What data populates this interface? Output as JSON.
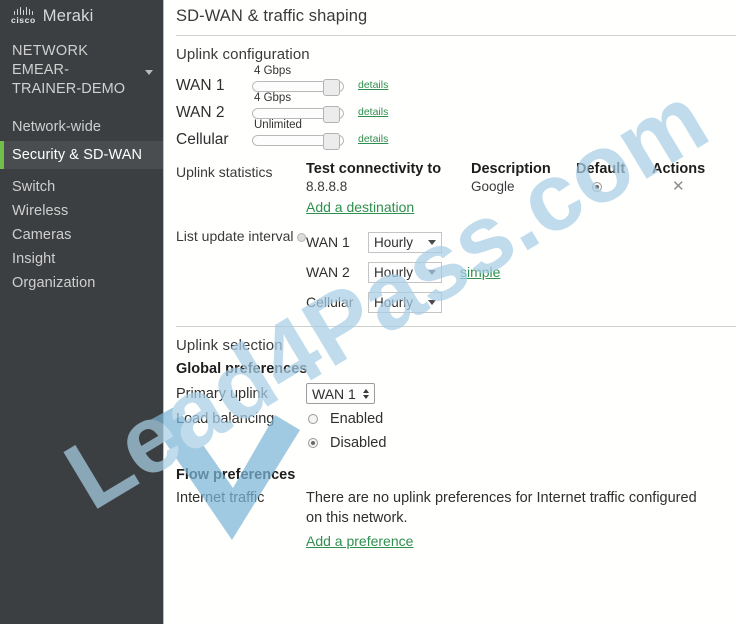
{
  "brand": {
    "cisco": "cisco",
    "product": "Meraki"
  },
  "sidebar": {
    "network_label": "NETWORK",
    "network_name": "EMEAR-TRAINER-DEMO",
    "items": [
      {
        "label": "Network-wide",
        "active": false
      },
      {
        "label": "Security & SD-WAN",
        "active": true
      },
      {
        "label": "Switch",
        "active": false
      },
      {
        "label": "Wireless",
        "active": false
      },
      {
        "label": "Cameras",
        "active": false
      },
      {
        "label": "Insight",
        "active": false
      },
      {
        "label": "Organization",
        "active": false
      }
    ],
    "accent_color": "#6fbf4a",
    "background_color": "#3c3f41"
  },
  "page": {
    "title": "SD-WAN & traffic shaping"
  },
  "uplink_configuration": {
    "heading": "Uplink configuration",
    "rows": [
      {
        "name": "WAN 1",
        "value": "4 Gbps",
        "details_label": "details"
      },
      {
        "name": "WAN 2",
        "value": "4 Gbps",
        "details_label": "details"
      },
      {
        "name": "Cellular",
        "value": "Unlimited",
        "details_label": "details"
      }
    ]
  },
  "uplink_statistics": {
    "label": "Uplink statistics",
    "columns": [
      "Test connectivity to",
      "Description",
      "Default",
      "Actions"
    ],
    "rows": [
      {
        "test": "8.8.8.8",
        "description": "Google",
        "default": true,
        "action_icon": "close-icon"
      }
    ],
    "add_link": "Add a destination"
  },
  "list_update_interval": {
    "label": "List update interval",
    "info_icon": "info-icon",
    "rows": [
      {
        "iface": "WAN 1",
        "interval": "Hourly"
      },
      {
        "iface": "WAN 2",
        "interval": "Hourly"
      },
      {
        "iface": "Cellular",
        "interval": "Hourly"
      }
    ],
    "simple_link": "simple"
  },
  "uplink_selection": {
    "heading": "Uplink selection",
    "global_preferences_title": "Global preferences",
    "primary_uplink_label": "Primary uplink",
    "primary_uplink_value": "WAN 1",
    "load_balancing_label": "Load balancing",
    "load_balancing_options": [
      {
        "label": "Enabled",
        "selected": false
      },
      {
        "label": "Disabled",
        "selected": true
      }
    ]
  },
  "flow_preferences": {
    "title": "Flow preferences",
    "internet_traffic_label": "Internet traffic",
    "empty_message": "There are no uplink preferences for Internet traffic configured on this network.",
    "add_link": "Add a preference"
  },
  "watermark": {
    "text": "Lead4Pass.com",
    "color": "#a9cfe6"
  }
}
